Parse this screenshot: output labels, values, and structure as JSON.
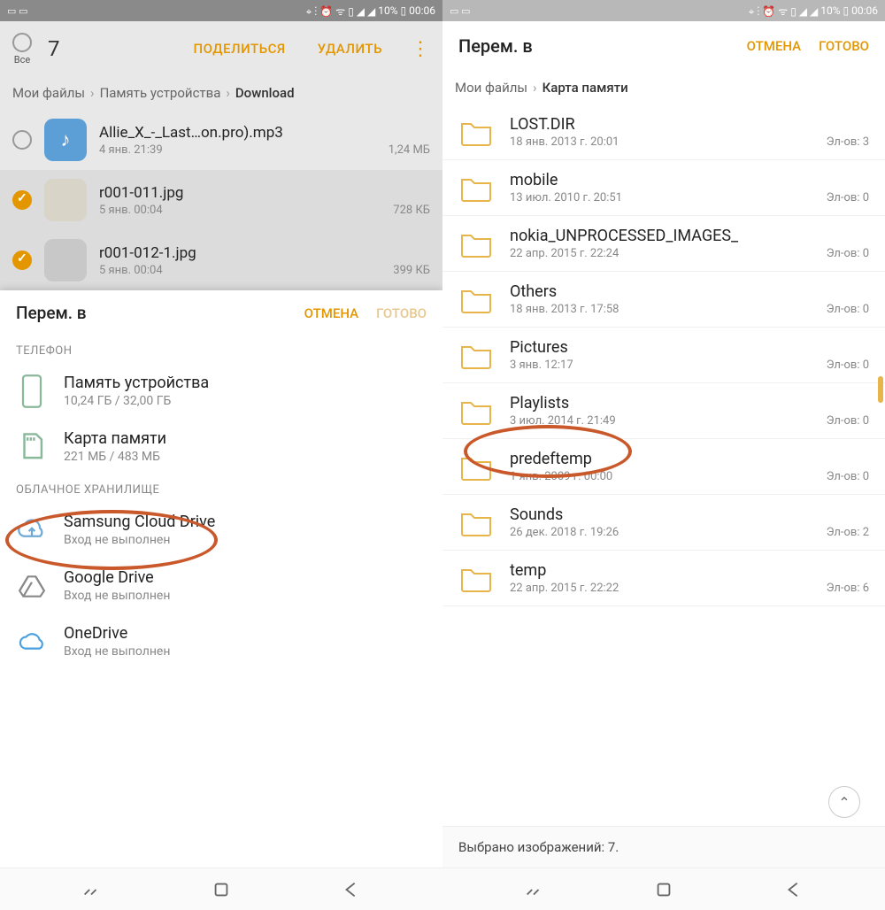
{
  "status": {
    "time": "00:06",
    "battery": "10%",
    "signal_alt": "⌖ ⋮ ⏰ ᯤ ▯ ▮◢"
  },
  "left": {
    "selection": {
      "all_label": "Все",
      "count": "7",
      "share": "ПОДЕЛИТЬСЯ",
      "delete": "УДАЛИТЬ"
    },
    "breadcrumb": [
      "Мои файлы",
      "Память устройства",
      "Download"
    ],
    "files": [
      {
        "name": "Allie_X_-_Last…on.pro).mp3",
        "date": "4 янв. 21:39",
        "size": "1,24 МБ",
        "selected": false,
        "type": "music"
      },
      {
        "name": "r001-011.jpg",
        "date": "5 янв. 00:04",
        "size": "728 КБ",
        "selected": true,
        "type": "photo1"
      },
      {
        "name": "r001-012-1.jpg",
        "date": "5 янв. 00:04",
        "size": "399 КБ",
        "selected": true,
        "type": "photo2"
      }
    ],
    "sheet": {
      "title": "Перем. в",
      "cancel": "ОТМЕНА",
      "done": "ГОТОВО",
      "sec_phone": "ТЕЛЕФОН",
      "sec_cloud": "ОБЛАЧНОЕ ХРАНИЛИЩЕ",
      "storage": [
        {
          "icon": "phone",
          "name": "Память устройства",
          "sub": "10,24 ГБ / 32,00 ГБ"
        },
        {
          "icon": "sd",
          "name": "Карта памяти",
          "sub": "221 МБ / 483 МБ"
        }
      ],
      "cloud": [
        {
          "icon": "samsung",
          "name": "Samsung Cloud Drive",
          "sub": "Вход не выполнен"
        },
        {
          "icon": "gdrive",
          "name": "Google Drive",
          "sub": "Вход не выполнен"
        },
        {
          "icon": "onedrive",
          "name": "OneDrive",
          "sub": "Вход не выполнен"
        }
      ]
    }
  },
  "right": {
    "title": "Перем. в",
    "cancel": "ОТМЕНА",
    "done": "ГОТОВО",
    "breadcrumb": [
      "Мои файлы",
      "Карта памяти"
    ],
    "folders": [
      {
        "name": "LOST.DIR",
        "date": "18 янв. 2013 г. 20:01",
        "count": "Эл-ов: 3"
      },
      {
        "name": "mobile",
        "date": "13 июл. 2010 г. 20:51",
        "count": "Эл-ов: 0"
      },
      {
        "name": "nokia_UNPROCESSED_IMAGES_",
        "date": "22 апр. 2015 г. 22:24",
        "count": "Эл-ов: 0"
      },
      {
        "name": "Others",
        "date": "18 янв. 2013 г. 17:58",
        "count": "Эл-ов: 0"
      },
      {
        "name": "Pictures",
        "date": "3 янв. 12:17",
        "count": "Эл-ов: 0"
      },
      {
        "name": "Playlists",
        "date": "3 июл. 2014 г. 21:49",
        "count": "Эл-ов: 0"
      },
      {
        "name": "predeftemp",
        "date": "1 янв. 2009 г. 00:00",
        "count": "Эл-ов: 0"
      },
      {
        "name": "Sounds",
        "date": "26 дек. 2018 г. 19:26",
        "count": "Эл-ов: 2"
      },
      {
        "name": "temp",
        "date": "22 апр. 2015 г. 22:22",
        "count": "Эл-ов: 6"
      }
    ],
    "bottom_status": "Выбрано изображений: 7."
  }
}
